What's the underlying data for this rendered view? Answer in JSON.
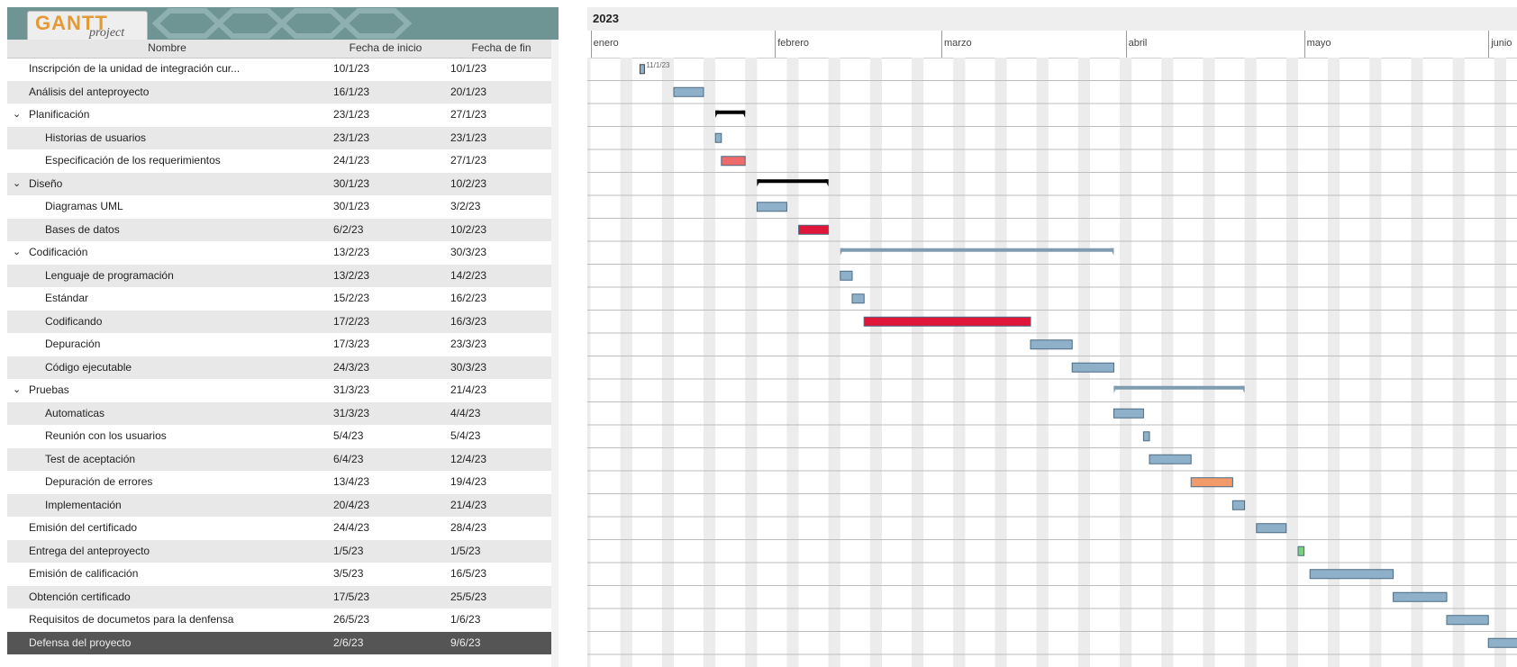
{
  "logo": {
    "word": "GANTT",
    "sub": "project"
  },
  "columns": {
    "name": "Nombre",
    "start": "Fecha de inicio",
    "end": "Fecha de fin"
  },
  "timeline": {
    "year": "2023",
    "months": [
      "enero",
      "febrero",
      "marzo",
      "abril",
      "mayo",
      "junio"
    ],
    "milestone_label": "11/1/23"
  },
  "tasks": [
    {
      "name": "Inscripción de la unidad de integración cur...",
      "start": "10/1/23",
      "end": "10/1/23",
      "indent": 0,
      "group": false,
      "color": "milestone",
      "s": 10,
      "e": 10
    },
    {
      "name": "Análisis del anteproyecto",
      "start": "16/1/23",
      "end": "20/1/23",
      "indent": 0,
      "group": false,
      "color": "#8fb0c9",
      "s": 16,
      "e": 20
    },
    {
      "name": "Planificación",
      "start": "23/1/23",
      "end": "27/1/23",
      "indent": 0,
      "group": true,
      "color": "#000000",
      "s": 23,
      "e": 27
    },
    {
      "name": "Historias de usuarios",
      "start": "23/1/23",
      "end": "23/1/23",
      "indent": 1,
      "group": false,
      "color": "#8fb0c9",
      "s": 23,
      "e": 23
    },
    {
      "name": "Especificación de los requerimientos",
      "start": "24/1/23",
      "end": "27/1/23",
      "indent": 1,
      "group": false,
      "color": "#ee6b6b",
      "s": 24,
      "e": 27
    },
    {
      "name": "Diseño",
      "start": "30/1/23",
      "end": "10/2/23",
      "indent": 0,
      "group": true,
      "color": "#000000",
      "s": 30,
      "e": 41
    },
    {
      "name": "Diagramas UML",
      "start": "30/1/23",
      "end": "3/2/23",
      "indent": 1,
      "group": false,
      "color": "#8fb0c9",
      "s": 30,
      "e": 34
    },
    {
      "name": "Bases de datos",
      "start": "6/2/23",
      "end": "10/2/23",
      "indent": 1,
      "group": false,
      "color": "#e0153a",
      "s": 37,
      "e": 41
    },
    {
      "name": "Codificación",
      "start": "13/2/23",
      "end": "30/3/23",
      "indent": 0,
      "group": true,
      "color": "#7f9cb0",
      "s": 44,
      "e": 89
    },
    {
      "name": "Lenguaje de programación",
      "start": "13/2/23",
      "end": "14/2/23",
      "indent": 1,
      "group": false,
      "color": "#8fb0c9",
      "s": 44,
      "e": 45
    },
    {
      "name": "Estándar",
      "start": "15/2/23",
      "end": "16/2/23",
      "indent": 1,
      "group": false,
      "color": "#8fb0c9",
      "s": 46,
      "e": 47
    },
    {
      "name": "Codificando",
      "start": "17/2/23",
      "end": "16/3/23",
      "indent": 1,
      "group": false,
      "color": "#e0153a",
      "s": 48,
      "e": 75
    },
    {
      "name": "Depuración",
      "start": "17/3/23",
      "end": "23/3/23",
      "indent": 1,
      "group": false,
      "color": "#8fb0c9",
      "s": 76,
      "e": 82
    },
    {
      "name": "Código ejecutable",
      "start": "24/3/23",
      "end": "30/3/23",
      "indent": 1,
      "group": false,
      "color": "#8fb0c9",
      "s": 83,
      "e": 89
    },
    {
      "name": "Pruebas",
      "start": "31/3/23",
      "end": "21/4/23",
      "indent": 0,
      "group": true,
      "color": "#7f9cb0",
      "s": 90,
      "e": 111
    },
    {
      "name": "Automaticas",
      "start": "31/3/23",
      "end": "4/4/23",
      "indent": 1,
      "group": false,
      "color": "#8fb0c9",
      "s": 90,
      "e": 94
    },
    {
      "name": "Reunión con los usuarios",
      "start": "5/4/23",
      "end": "5/4/23",
      "indent": 1,
      "group": false,
      "color": "#8fb0c9",
      "s": 95,
      "e": 95
    },
    {
      "name": "Test de aceptación",
      "start": "6/4/23",
      "end": "12/4/23",
      "indent": 1,
      "group": false,
      "color": "#8fb0c9",
      "s": 96,
      "e": 102
    },
    {
      "name": "Depuración de errores",
      "start": "13/4/23",
      "end": "19/4/23",
      "indent": 1,
      "group": false,
      "color": "#f39a6a",
      "s": 103,
      "e": 109
    },
    {
      "name": "Implementación",
      "start": "20/4/23",
      "end": "21/4/23",
      "indent": 1,
      "group": false,
      "color": "#8fb0c9",
      "s": 110,
      "e": 111
    },
    {
      "name": "Emisión del certificado",
      "start": "24/4/23",
      "end": "28/4/23",
      "indent": 0,
      "group": false,
      "color": "#8fb0c9",
      "s": 114,
      "e": 118
    },
    {
      "name": "Entrega del anteproyecto",
      "start": "1/5/23",
      "end": "1/5/23",
      "indent": 0,
      "group": false,
      "color": "#7ccf7c",
      "s": 121,
      "e": 121
    },
    {
      "name": "Emisión de calificación",
      "start": "3/5/23",
      "end": "16/5/23",
      "indent": 0,
      "group": false,
      "color": "#8fb0c9",
      "s": 123,
      "e": 136
    },
    {
      "name": "Obtención certificado",
      "start": "17/5/23",
      "end": "25/5/23",
      "indent": 0,
      "group": false,
      "color": "#8fb0c9",
      "s": 137,
      "e": 145
    },
    {
      "name": "Requisitos de documetos para la denfensa",
      "start": "26/5/23",
      "end": "1/6/23",
      "indent": 0,
      "group": false,
      "color": "#8fb0c9",
      "s": 146,
      "e": 152
    },
    {
      "name": "Defensa del proyecto",
      "start": "2/6/23",
      "end": "9/6/23",
      "indent": 0,
      "group": false,
      "color": "#8fb0c9",
      "s": 153,
      "e": 160,
      "selected": true
    }
  ]
}
